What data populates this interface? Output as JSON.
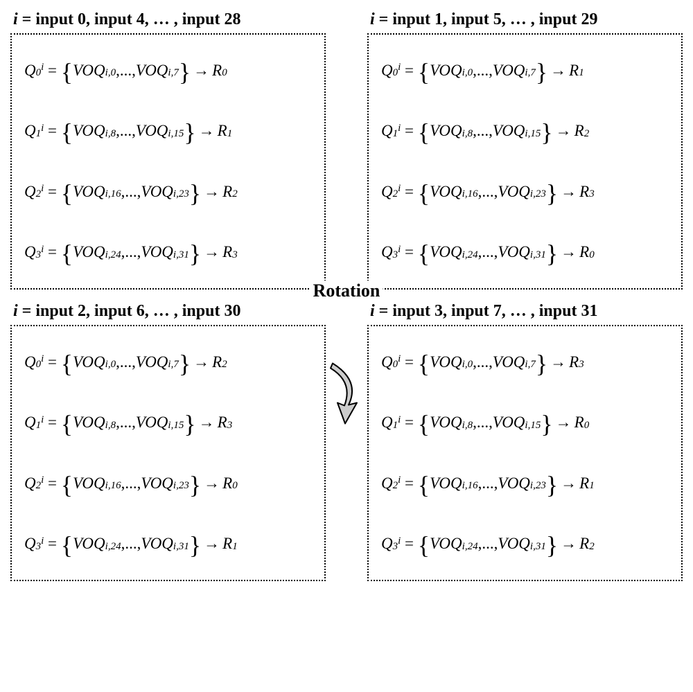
{
  "rotation_label": "Rotation",
  "quads": [
    {
      "title_prefix": "i",
      "title": " = input 0, input 4, … , input 28",
      "rows": [
        {
          "q_sub": "0",
          "voq_from_sub": "i,0",
          "voq_to_sub": "i,7",
          "r_sub": "0"
        },
        {
          "q_sub": "1",
          "voq_from_sub": "i,8",
          "voq_to_sub": "i,15",
          "r_sub": "1"
        },
        {
          "q_sub": "2",
          "voq_from_sub": "i,16",
          "voq_to_sub": "i,23",
          "r_sub": "2"
        },
        {
          "q_sub": "3",
          "voq_from_sub": "i,24",
          "voq_to_sub": "i,31",
          "r_sub": "3"
        }
      ]
    },
    {
      "title_prefix": "i",
      "title": " = input 1, input 5, … , input 29",
      "rows": [
        {
          "q_sub": "0",
          "voq_from_sub": "i,0",
          "voq_to_sub": "i,7",
          "r_sub": "1"
        },
        {
          "q_sub": "1",
          "voq_from_sub": "i,8",
          "voq_to_sub": "i,15",
          "r_sub": "2"
        },
        {
          "q_sub": "2",
          "voq_from_sub": "i,16",
          "voq_to_sub": "i,23",
          "r_sub": "3"
        },
        {
          "q_sub": "3",
          "voq_from_sub": "i,24",
          "voq_to_sub": "i,31",
          "r_sub": "0"
        }
      ]
    },
    {
      "title_prefix": "i",
      "title": " = input 2, input 6, … , input 30",
      "rows": [
        {
          "q_sub": "0",
          "voq_from_sub": "i,0",
          "voq_to_sub": "i,7",
          "r_sub": "2"
        },
        {
          "q_sub": "1",
          "voq_from_sub": "i,8",
          "voq_to_sub": "i,15",
          "r_sub": "3"
        },
        {
          "q_sub": "2",
          "voq_from_sub": "i,16",
          "voq_to_sub": "i,23",
          "r_sub": "0"
        },
        {
          "q_sub": "3",
          "voq_from_sub": "i,24",
          "voq_to_sub": "i,31",
          "r_sub": "1"
        }
      ]
    },
    {
      "title_prefix": "i",
      "title": " = input 3, input 7, … , input 31",
      "rows": [
        {
          "q_sub": "0",
          "voq_from_sub": "i,0",
          "voq_to_sub": "i,7",
          "r_sub": "3"
        },
        {
          "q_sub": "1",
          "voq_from_sub": "i,8",
          "voq_to_sub": "i,15",
          "r_sub": "0"
        },
        {
          "q_sub": "2",
          "voq_from_sub": "i,16",
          "voq_to_sub": "i,23",
          "r_sub": "1"
        },
        {
          "q_sub": "3",
          "voq_from_sub": "i,24",
          "voq_to_sub": "i,31",
          "r_sub": "2"
        }
      ]
    }
  ]
}
